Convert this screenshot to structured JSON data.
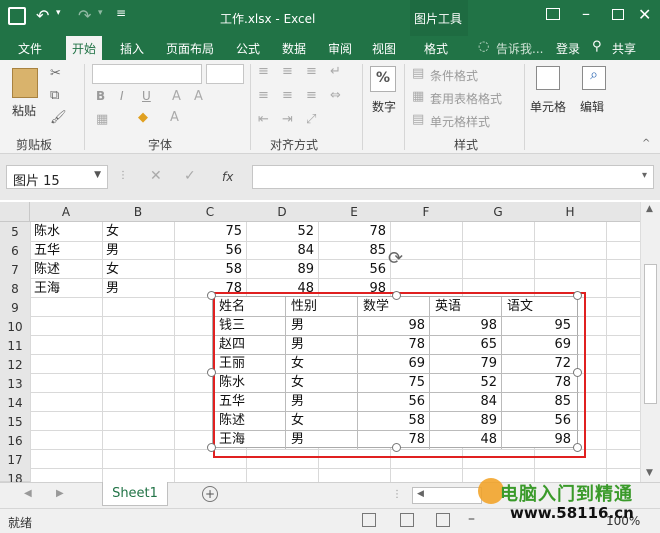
{
  "window": {
    "title": "工作.xlsx - Excel",
    "context_tab_group": "图片工具",
    "user": "登录",
    "share": "共享",
    "tell_me": "告诉我..."
  },
  "tabs": [
    "文件",
    "开始",
    "插入",
    "页面布局",
    "公式",
    "数据",
    "审阅",
    "视图",
    "格式"
  ],
  "active_tab": "开始",
  "ribbon": {
    "paste": "粘贴",
    "clipboard": "剪贴板",
    "font": "字体",
    "alignment": "对齐方式",
    "number": "数字",
    "number_group_symbol": "%",
    "conditional_format": "条件格式",
    "table_format": "套用表格格式",
    "cell_style": "单元格样式",
    "styles": "样式",
    "cells": "单元格",
    "editing": "编辑",
    "bold": "B",
    "italic": "I",
    "underline": "U"
  },
  "name_box": "图片 15",
  "fx_label": "fx",
  "columns": [
    "A",
    "B",
    "C",
    "D",
    "E",
    "F",
    "G",
    "H"
  ],
  "rows": [
    "5",
    "6",
    "7",
    "8",
    "9",
    "10",
    "11",
    "12",
    "13",
    "14",
    "15",
    "16",
    "17",
    "18"
  ],
  "sheet_rows": [
    {
      "name": "陈水",
      "gender": "女",
      "c": "75",
      "d": "52",
      "e": "78"
    },
    {
      "name": "五华",
      "gender": "男",
      "c": "56",
      "d": "84",
      "e": "85"
    },
    {
      "name": "陈述",
      "gender": "女",
      "c": "58",
      "d": "89",
      "e": "56"
    },
    {
      "name": "王海",
      "gender": "男",
      "c": "78",
      "d": "48",
      "e": "98"
    }
  ],
  "picture": {
    "headers": [
      "姓名",
      "性别",
      "数学",
      "英语",
      "语文"
    ],
    "rows": [
      [
        "钱三",
        "男",
        "98",
        "98",
        "95"
      ],
      [
        "赵四",
        "男",
        "78",
        "65",
        "69"
      ],
      [
        "王丽",
        "女",
        "69",
        "79",
        "72"
      ],
      [
        "陈水",
        "女",
        "75",
        "52",
        "78"
      ],
      [
        "五华",
        "男",
        "56",
        "84",
        "85"
      ],
      [
        "陈述",
        "女",
        "58",
        "89",
        "56"
      ],
      [
        "王海",
        "男",
        "78",
        "48",
        "98"
      ]
    ]
  },
  "sheet_tab": "Sheet1",
  "status": "就绪",
  "zoom": "100%",
  "watermark": {
    "line1": "电脑入门到精通",
    "line2": "www.58116.cn"
  },
  "colors": {
    "accent": "#217346",
    "selection": "#e02020"
  }
}
